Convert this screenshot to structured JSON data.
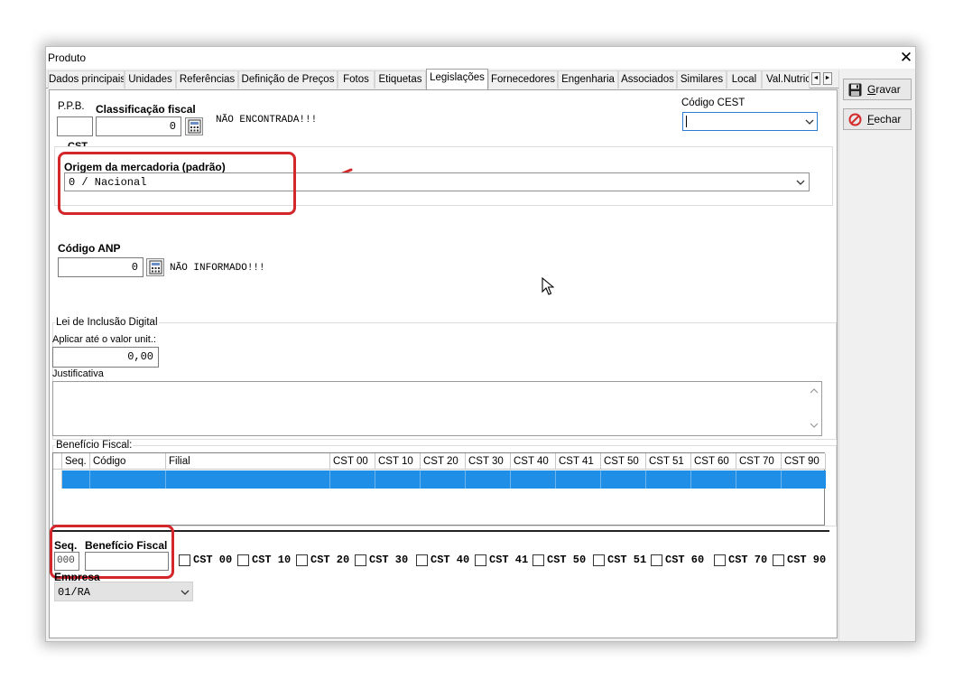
{
  "window": {
    "title": "Produto",
    "close_glyph": "✕"
  },
  "tabs": [
    {
      "label": "Dados principais"
    },
    {
      "label": "Unidades"
    },
    {
      "label": "Referências"
    },
    {
      "label": "Definição de Preços"
    },
    {
      "label": "Fotos"
    },
    {
      "label": "Etiquetas"
    },
    {
      "label": "Legislações",
      "active": true
    },
    {
      "label": "Fornecedores"
    },
    {
      "label": "Engenharia"
    },
    {
      "label": "Associados"
    },
    {
      "label": "Similares"
    },
    {
      "label": "Local"
    },
    {
      "label": "Val.Nutric"
    }
  ],
  "tab_scroll": {
    "left": "◄",
    "right": "►"
  },
  "buttons": {
    "gravar": "Gravar",
    "gravar_key": "G",
    "gravar_rest": "ravar",
    "fechar_key": "F",
    "fechar_rest": "echar"
  },
  "ppb": {
    "label": "P.P.B.",
    "value": ""
  },
  "classificacao": {
    "label": "Classificação fiscal",
    "value": "0",
    "status": "NÃO ENCONTRADA!!!"
  },
  "cest": {
    "label": "Código CEST",
    "value": ""
  },
  "cst": {
    "legend": "CST"
  },
  "origem": {
    "label": "Origem da mercadoria (padrão)",
    "value": "0 / Nacional"
  },
  "anp": {
    "label": "Código ANP",
    "value": "0",
    "status": "NÃO INFORMADO!!!"
  },
  "lei_inclusao": {
    "legend": "Lei de Inclusão Digital",
    "aplicar_label": "Aplicar até o valor unit.:",
    "aplicar_value": "0,00",
    "justificativa_label": "Justificativa",
    "justificativa_value": ""
  },
  "beneficio_grid": {
    "legend": "Benefício Fiscal:",
    "columns": [
      "Seq.",
      "Código",
      "Filial",
      "CST 00",
      "CST 10",
      "CST 20",
      "CST 30",
      "CST 40",
      "CST 41",
      "CST 50",
      "CST 51",
      "CST 60",
      "CST 70",
      "CST 90"
    ]
  },
  "beneficio_editor": {
    "seq_label": "Seq.",
    "seq_value": "000",
    "beneficio_label": "Benefício Fiscal",
    "beneficio_value": "",
    "cst_checks": [
      "CST 00",
      "CST 10",
      "CST 20",
      "CST 30",
      "CST 40",
      "CST 41",
      "CST 50",
      "CST 51",
      "CST 60",
      "CST 70",
      "CST 90"
    ]
  },
  "empresa": {
    "label": "Empresa",
    "value": "01/RA"
  },
  "colors": {
    "highlight": "#d3272c",
    "selection": "#1e8ee6",
    "arrow": "#d3272c"
  }
}
